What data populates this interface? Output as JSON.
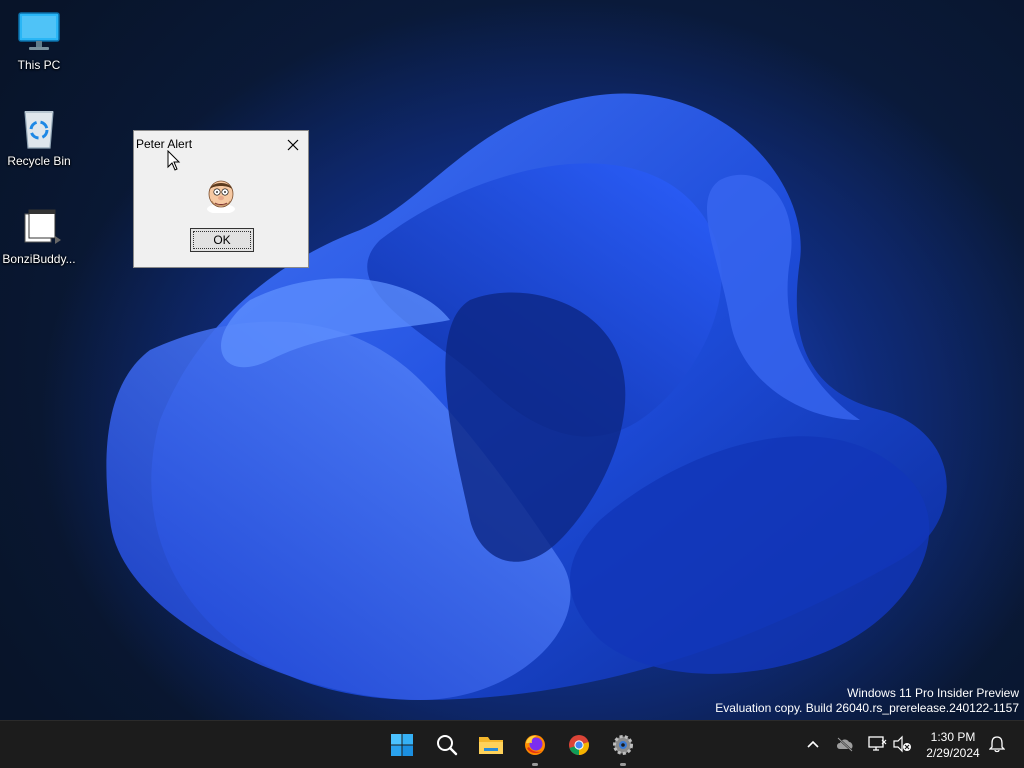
{
  "desktop": {
    "icons": [
      {
        "label": "This PC",
        "icon": "monitor-icon"
      },
      {
        "label": "Recycle Bin",
        "icon": "recycle-bin-icon"
      },
      {
        "label": "BonziBuddy...",
        "icon": "file-shortcut-icon"
      }
    ]
  },
  "dialog": {
    "title": "Peter Alert",
    "ok_label": "OK",
    "image": "peter-face-icon",
    "close_icon": "close-icon"
  },
  "watermark": {
    "line1": "Windows 11 Pro Insider Preview",
    "line2": "Evaluation copy. Build 26040.rs_prerelease.240122-1157"
  },
  "taskbar": {
    "apps": [
      {
        "name": "Start",
        "icon": "windows-start-icon"
      },
      {
        "name": "Search",
        "icon": "search-icon"
      },
      {
        "name": "File Explorer",
        "icon": "folder-icon"
      },
      {
        "name": "Firefox",
        "icon": "firefox-icon",
        "running": true
      },
      {
        "name": "Chrome",
        "icon": "chrome-icon"
      },
      {
        "name": "Settings",
        "icon": "settings-gear-icon",
        "running": true
      }
    ],
    "tray": {
      "icons": [
        "chevron-up-icon",
        "cloud-offline-icon",
        "network-icon",
        "volume-muted-icon",
        "notification-bell-icon"
      ]
    },
    "clock": {
      "time": "1:30 PM",
      "date": "2/29/2024"
    }
  },
  "colors": {
    "taskbar_bg": "#1c1c1c",
    "wallpaper_accent": "#1e47c9",
    "dialog_bg": "#f0f0f0"
  }
}
